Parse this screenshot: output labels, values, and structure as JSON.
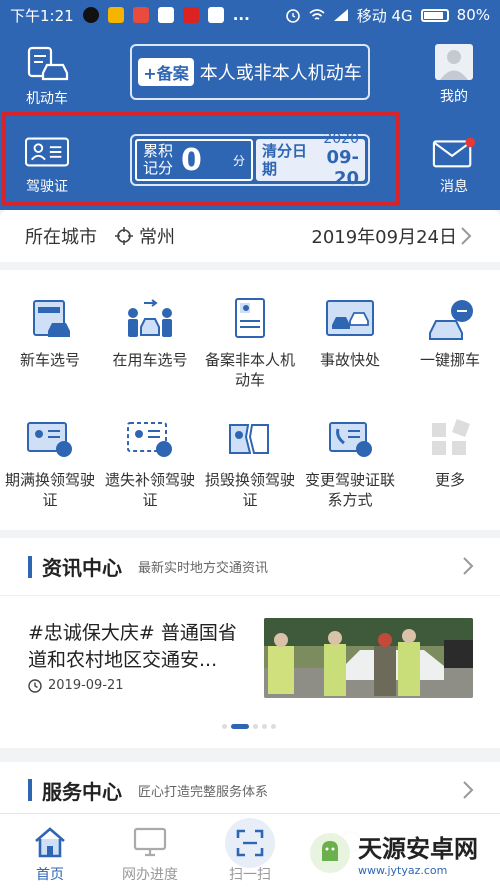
{
  "status_bar": {
    "time": "下午1:21",
    "carrier": "移动 4G",
    "battery": "80%",
    "more": "..."
  },
  "header": {
    "vehicle_label": "机动车",
    "license_label": "驾驶证",
    "mine_label": "我的",
    "message_label": "消息",
    "banner_tag": "+备案",
    "banner_text": "本人或非本人机动车",
    "score_label": "累积记分",
    "score_value": "0",
    "score_unit": "分",
    "clear_label": "清分日期",
    "clear_year": "2020",
    "clear_date": "09-20"
  },
  "city_row": {
    "label": "所在城市",
    "city": "常州",
    "date": "2019年09月24日"
  },
  "services": [
    {
      "label": "新车选号",
      "icon": "new-car-plate-icon"
    },
    {
      "label": "在用车选号",
      "icon": "used-car-plate-icon"
    },
    {
      "label": "备案非本人机动车",
      "icon": "register-vehicle-icon"
    },
    {
      "label": "事故快处",
      "icon": "accident-icon"
    },
    {
      "label": "一键挪车",
      "icon": "move-car-icon"
    },
    {
      "label": "期满换领驾驶证",
      "icon": "license-renew-icon"
    },
    {
      "label": "遗失补领驾驶证",
      "icon": "license-lost-icon"
    },
    {
      "label": "损毁换领驾驶证",
      "icon": "license-damaged-icon"
    },
    {
      "label": "变更驾驶证联系方式",
      "icon": "contact-change-icon"
    },
    {
      "label": "更多",
      "icon": "more-icon"
    }
  ],
  "news": {
    "title": "资讯中心",
    "subtitle": "最新实时地方交通资讯",
    "headline": "#忠诚保大庆# 普通国省道和农村地区交通安...",
    "date": "2019-09-21"
  },
  "service_center": {
    "title": "服务中心",
    "subtitle": "匠心打造完整服务体系"
  },
  "tabs": [
    {
      "label": "首页",
      "icon": "home-icon",
      "active": true
    },
    {
      "label": "网办进度",
      "icon": "monitor-icon",
      "active": false
    },
    {
      "label": "扫一扫",
      "icon": "scan-icon",
      "active": false
    }
  ],
  "watermark": {
    "name": "天源安卓网",
    "url": "www.jytyaz.com"
  },
  "colors": {
    "primary": "#2f66b4",
    "highlight": "#d8232a"
  }
}
